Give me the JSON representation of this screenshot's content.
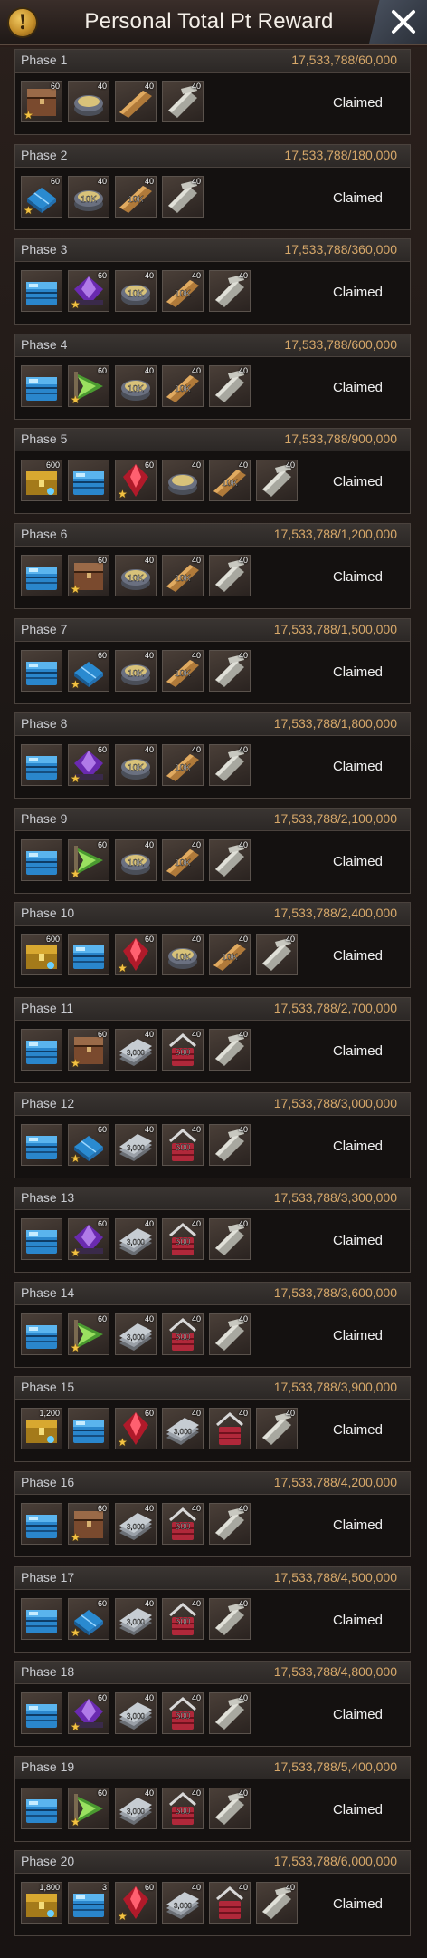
{
  "header": {
    "title": "Personal Total Pt Reward",
    "info_icon": "info-icon",
    "close_icon": "close-icon"
  },
  "colors": {
    "progress": "#d7a86a",
    "claimed": "#f0f0f0",
    "star": "#f3c242"
  },
  "status_label": "Claimed",
  "phases": [
    {
      "name": "Phase 1",
      "progress": "17,533,788/60,000",
      "items": [
        {
          "icon": "wooden-chest-icon",
          "qty": "60",
          "star": true
        },
        {
          "icon": "rations-pouch-icon",
          "qty": "40",
          "label": ""
        },
        {
          "icon": "wood-planks-icon",
          "qty": "40"
        },
        {
          "icon": "metal-ingots-icon",
          "qty": "40"
        }
      ]
    },
    {
      "name": "Phase 2",
      "progress": "17,533,788/180,000",
      "items": [
        {
          "icon": "blue-crate-icon",
          "qty": "60",
          "star": true
        },
        {
          "icon": "rations-pouch-icon",
          "qty": "40",
          "label": "10K"
        },
        {
          "icon": "wood-planks-icon",
          "qty": "40",
          "label": "10K"
        },
        {
          "icon": "metal-ingots-icon",
          "qty": "40"
        }
      ]
    },
    {
      "name": "Phase 3",
      "progress": "17,533,788/360,000",
      "items": [
        {
          "icon": "blue-chest-icon",
          "qty": ""
        },
        {
          "icon": "purple-gem-chest-icon",
          "qty": "60",
          "star": true
        },
        {
          "icon": "rations-pouch-icon",
          "qty": "40",
          "label": "10K"
        },
        {
          "icon": "wood-planks-icon",
          "qty": "40",
          "label": "10K"
        },
        {
          "icon": "metal-ingots-icon",
          "qty": "40"
        }
      ]
    },
    {
      "name": "Phase 4",
      "progress": "17,533,788/600,000",
      "items": [
        {
          "icon": "blue-chest-icon",
          "qty": ""
        },
        {
          "icon": "green-arrow-icon",
          "qty": "60",
          "star": true
        },
        {
          "icon": "rations-pouch-icon",
          "qty": "40",
          "label": "10K"
        },
        {
          "icon": "wood-planks-icon",
          "qty": "40",
          "label": "10K"
        },
        {
          "icon": "metal-ingots-icon",
          "qty": "40"
        }
      ]
    },
    {
      "name": "Phase 5",
      "progress": "17,533,788/900,000",
      "items": [
        {
          "icon": "gold-chest-icon",
          "qty": "600"
        },
        {
          "icon": "blue-chest-icon",
          "qty": ""
        },
        {
          "icon": "red-crystal-icon",
          "qty": "60",
          "star": true
        },
        {
          "icon": "rations-pouch-icon",
          "qty": "40"
        },
        {
          "icon": "wood-planks-icon",
          "qty": "40",
          "label": "10K"
        },
        {
          "icon": "metal-ingots-icon",
          "qty": "40"
        }
      ]
    },
    {
      "name": "Phase 6",
      "progress": "17,533,788/1,200,000",
      "items": [
        {
          "icon": "blue-chest-icon",
          "qty": ""
        },
        {
          "icon": "wooden-chest-icon",
          "qty": "60",
          "star": true
        },
        {
          "icon": "rations-pouch-icon",
          "qty": "40",
          "label": "10K"
        },
        {
          "icon": "wood-planks-icon",
          "qty": "40",
          "label": "10K"
        },
        {
          "icon": "metal-ingots-icon",
          "qty": "40"
        }
      ]
    },
    {
      "name": "Phase 7",
      "progress": "17,533,788/1,500,000",
      "items": [
        {
          "icon": "blue-chest-icon",
          "qty": ""
        },
        {
          "icon": "blue-crate-icon",
          "qty": "60",
          "star": true
        },
        {
          "icon": "rations-pouch-icon",
          "qty": "40",
          "label": "10K"
        },
        {
          "icon": "wood-planks-icon",
          "qty": "40",
          "label": "10K"
        },
        {
          "icon": "metal-ingots-icon",
          "qty": "40"
        }
      ]
    },
    {
      "name": "Phase 8",
      "progress": "17,533,788/1,800,000",
      "items": [
        {
          "icon": "blue-chest-icon",
          "qty": ""
        },
        {
          "icon": "purple-gem-chest-icon",
          "qty": "60",
          "star": true
        },
        {
          "icon": "rations-pouch-icon",
          "qty": "40",
          "label": "10K"
        },
        {
          "icon": "wood-planks-icon",
          "qty": "40",
          "label": "10K"
        },
        {
          "icon": "metal-ingots-icon",
          "qty": "40"
        }
      ]
    },
    {
      "name": "Phase 9",
      "progress": "17,533,788/2,100,000",
      "items": [
        {
          "icon": "blue-chest-icon",
          "qty": ""
        },
        {
          "icon": "green-arrow-icon",
          "qty": "60",
          "star": true
        },
        {
          "icon": "rations-pouch-icon",
          "qty": "40",
          "label": "10K"
        },
        {
          "icon": "wood-planks-icon",
          "qty": "40",
          "label": "10K"
        },
        {
          "icon": "metal-ingots-icon",
          "qty": "40"
        }
      ]
    },
    {
      "name": "Phase 10",
      "progress": "17,533,788/2,400,000",
      "items": [
        {
          "icon": "gold-chest-icon",
          "qty": "600"
        },
        {
          "icon": "blue-chest-icon",
          "qty": ""
        },
        {
          "icon": "red-crystal-icon",
          "qty": "60",
          "star": true
        },
        {
          "icon": "rations-pouch-icon",
          "qty": "40",
          "label": "10K"
        },
        {
          "icon": "wood-planks-icon",
          "qty": "40",
          "label": "10K"
        },
        {
          "icon": "metal-ingots-icon",
          "qty": "40"
        }
      ]
    },
    {
      "name": "Phase 11",
      "progress": "17,533,788/2,700,000",
      "items": [
        {
          "icon": "blue-chest-icon",
          "qty": ""
        },
        {
          "icon": "wooden-chest-icon",
          "qty": "60",
          "star": true
        },
        {
          "icon": "steel-plates-icon",
          "qty": "40",
          "label": "3,000"
        },
        {
          "icon": "red-basket-icon",
          "qty": "40",
          "label": "500"
        },
        {
          "icon": "metal-ingots-icon",
          "qty": "40"
        }
      ]
    },
    {
      "name": "Phase 12",
      "progress": "17,533,788/3,000,000",
      "items": [
        {
          "icon": "blue-chest-icon",
          "qty": ""
        },
        {
          "icon": "blue-crate-icon",
          "qty": "60",
          "star": true
        },
        {
          "icon": "steel-plates-icon",
          "qty": "40",
          "label": "3,000"
        },
        {
          "icon": "red-basket-icon",
          "qty": "40",
          "label": "500"
        },
        {
          "icon": "metal-ingots-icon",
          "qty": "40"
        }
      ]
    },
    {
      "name": "Phase 13",
      "progress": "17,533,788/3,300,000",
      "items": [
        {
          "icon": "blue-chest-icon",
          "qty": ""
        },
        {
          "icon": "purple-gem-chest-icon",
          "qty": "60",
          "star": true
        },
        {
          "icon": "steel-plates-icon",
          "qty": "40",
          "label": "3,000"
        },
        {
          "icon": "red-basket-icon",
          "qty": "40",
          "label": "500"
        },
        {
          "icon": "metal-ingots-icon",
          "qty": "40"
        }
      ]
    },
    {
      "name": "Phase 14",
      "progress": "17,533,788/3,600,000",
      "items": [
        {
          "icon": "blue-chest-icon",
          "qty": ""
        },
        {
          "icon": "green-arrow-icon",
          "qty": "60",
          "star": true
        },
        {
          "icon": "steel-plates-icon",
          "qty": "40",
          "label": "3,000"
        },
        {
          "icon": "red-basket-icon",
          "qty": "40",
          "label": "500"
        },
        {
          "icon": "metal-ingots-icon",
          "qty": "40"
        }
      ]
    },
    {
      "name": "Phase 15",
      "progress": "17,533,788/3,900,000",
      "items": [
        {
          "icon": "gold-chest-icon",
          "qty": "1,200"
        },
        {
          "icon": "blue-chest-icon",
          "qty": ""
        },
        {
          "icon": "red-crystal-icon",
          "qty": "60",
          "star": true
        },
        {
          "icon": "steel-plates-icon",
          "qty": "40",
          "label": "3,000"
        },
        {
          "icon": "red-basket-icon",
          "qty": "40"
        },
        {
          "icon": "metal-ingots-icon",
          "qty": "40"
        }
      ]
    },
    {
      "name": "Phase 16",
      "progress": "17,533,788/4,200,000",
      "items": [
        {
          "icon": "blue-chest-icon",
          "qty": ""
        },
        {
          "icon": "wooden-chest-icon",
          "qty": "60",
          "star": true
        },
        {
          "icon": "steel-plates-icon",
          "qty": "40",
          "label": "3,000"
        },
        {
          "icon": "red-basket-icon",
          "qty": "40",
          "label": "500"
        },
        {
          "icon": "metal-ingots-icon",
          "qty": "40"
        }
      ]
    },
    {
      "name": "Phase 17",
      "progress": "17,533,788/4,500,000",
      "items": [
        {
          "icon": "blue-chest-icon",
          "qty": ""
        },
        {
          "icon": "blue-crate-icon",
          "qty": "60",
          "star": true
        },
        {
          "icon": "steel-plates-icon",
          "qty": "40",
          "label": "3,000"
        },
        {
          "icon": "red-basket-icon",
          "qty": "40",
          "label": "500"
        },
        {
          "icon": "metal-ingots-icon",
          "qty": "40"
        }
      ]
    },
    {
      "name": "Phase 18",
      "progress": "17,533,788/4,800,000",
      "items": [
        {
          "icon": "blue-chest-icon",
          "qty": ""
        },
        {
          "icon": "purple-gem-chest-icon",
          "qty": "60",
          "star": true
        },
        {
          "icon": "steel-plates-icon",
          "qty": "40",
          "label": "3,000"
        },
        {
          "icon": "red-basket-icon",
          "qty": "40",
          "label": "500"
        },
        {
          "icon": "metal-ingots-icon",
          "qty": "40"
        }
      ]
    },
    {
      "name": "Phase 19",
      "progress": "17,533,788/5,400,000",
      "items": [
        {
          "icon": "blue-chest-icon",
          "qty": ""
        },
        {
          "icon": "green-arrow-icon",
          "qty": "60",
          "star": true
        },
        {
          "icon": "steel-plates-icon",
          "qty": "40",
          "label": "3,000"
        },
        {
          "icon": "red-basket-icon",
          "qty": "40",
          "label": "500"
        },
        {
          "icon": "metal-ingots-icon",
          "qty": "40"
        }
      ]
    },
    {
      "name": "Phase 20",
      "progress": "17,533,788/6,000,000",
      "items": [
        {
          "icon": "gold-chest-icon",
          "qty": "1,800"
        },
        {
          "icon": "blue-chest-icon",
          "qty": "3"
        },
        {
          "icon": "red-crystal-icon",
          "qty": "60",
          "star": true
        },
        {
          "icon": "steel-plates-icon",
          "qty": "40",
          "label": "3,000"
        },
        {
          "icon": "red-basket-icon",
          "qty": "40"
        },
        {
          "icon": "metal-ingots-icon",
          "qty": "40"
        }
      ]
    }
  ]
}
